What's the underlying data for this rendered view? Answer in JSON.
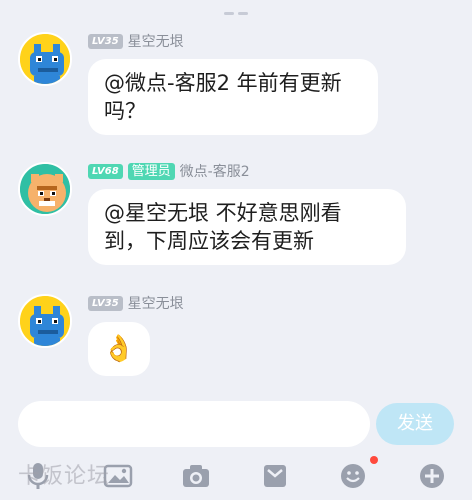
{
  "messages": [
    {
      "level": "LV35",
      "role": "",
      "username": "星空无垠",
      "text_line1": "@微点-客服2 年前有更新",
      "text_line2": "吗？"
    },
    {
      "level": "LV68",
      "role": "管理员",
      "username": "微点-客服2",
      "text_line1": "@星空无垠 不好意思刚看",
      "text_line2": "到，下周应该会有更新"
    },
    {
      "level": "LV35",
      "role": "",
      "username": "星空无垠",
      "emoji": "👌"
    }
  ],
  "composer": {
    "placeholder": "",
    "send_label": "发送"
  },
  "watermark": "卡饭论坛",
  "colors": {
    "background": "#eef0f6",
    "send_button": "#bfe6f6",
    "level_badge": "#b9bec8",
    "admin_badge": "#4fd7b3",
    "notification_dot": "#ff4a3d"
  },
  "toolbar_icons": [
    "microphone-icon",
    "image-icon",
    "camera-icon",
    "mailbox-icon",
    "emoji-icon",
    "plus-icon"
  ]
}
